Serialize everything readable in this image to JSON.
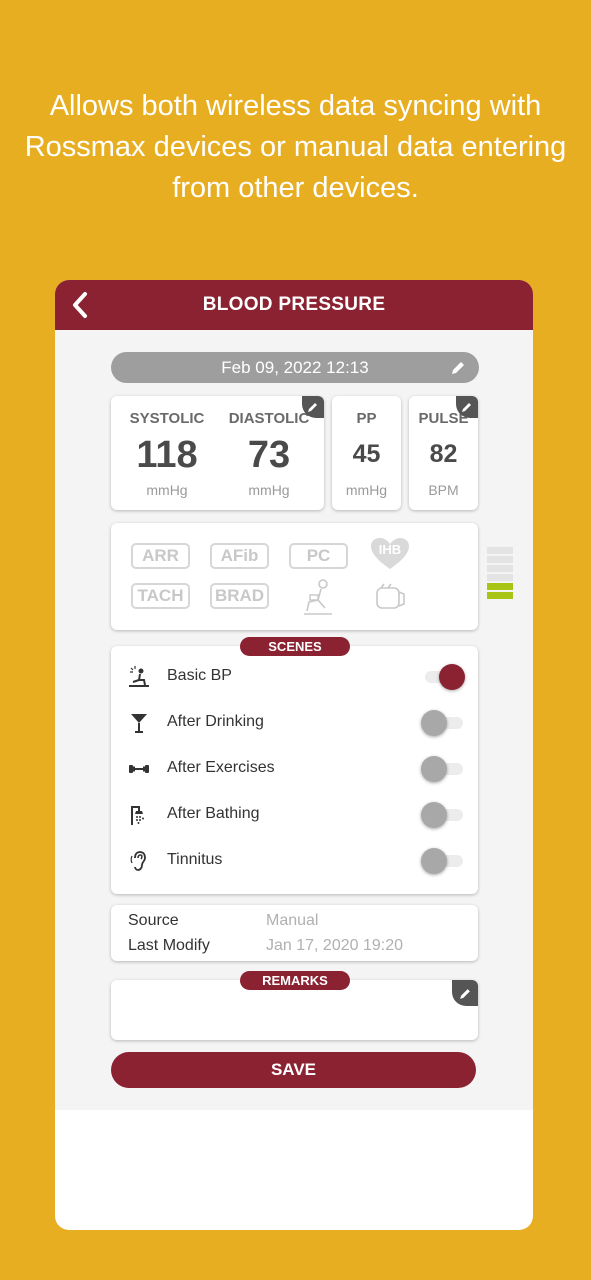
{
  "promo_text": "Allows both wireless data syncing with Rossmax devices or manual data entering from other devices.",
  "header": {
    "title": "BLOOD PRESSURE",
    "back_icon": "chevron-left-icon"
  },
  "datetime": {
    "value": "Feb 09, 2022 12:13",
    "edit_icon": "pencil-icon"
  },
  "measurements": {
    "systolic": {
      "label": "SYSTOLIC",
      "value": "118",
      "unit": "mmHg"
    },
    "diastolic": {
      "label": "DIASTOLIC",
      "value": "73",
      "unit": "mmHg"
    },
    "pp": {
      "label": "PP",
      "value": "45",
      "unit": "mmHg"
    },
    "pulse": {
      "label": "PULSE",
      "value": "82",
      "unit": "BPM"
    }
  },
  "indicators": {
    "badges": [
      "ARR",
      "AFib",
      "PC",
      "TACH",
      "BRAD"
    ],
    "ihb_label": "IHB",
    "level": {
      "filled": 2,
      "total": 6,
      "filled_color": "#A8C515",
      "empty_color": "#E3E3E3"
    }
  },
  "scenes": {
    "label": "SCENES",
    "items": [
      {
        "label": "Basic BP",
        "icon": "person-resting-icon",
        "on": true
      },
      {
        "label": "After Drinking",
        "icon": "cocktail-glass-icon",
        "on": false
      },
      {
        "label": "After Exercises",
        "icon": "dumbbell-icon",
        "on": false
      },
      {
        "label": "After Bathing",
        "icon": "shower-icon",
        "on": false
      },
      {
        "label": "Tinnitus",
        "icon": "ear-icon",
        "on": false
      }
    ]
  },
  "info": {
    "source_label": "Source",
    "source_value": "Manual",
    "modify_label": "Last Modify",
    "modify_value": "Jan 17, 2020 19:20"
  },
  "remarks": {
    "label": "REMARKS",
    "text": ""
  },
  "save_label": "SAVE",
  "colors": {
    "background": "#E8AE22",
    "primary": "#8B2232",
    "date_bar": "#9E9E9E"
  }
}
